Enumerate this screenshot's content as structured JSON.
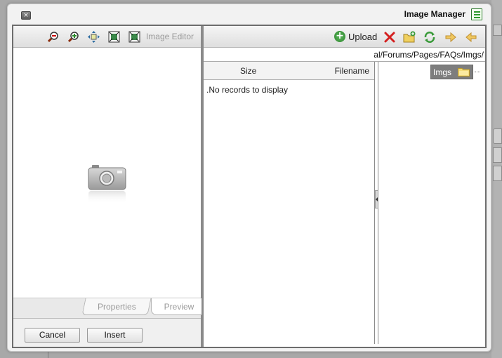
{
  "dialog": {
    "title": "Image Manager",
    "close_symbol": "×",
    "colors": {
      "toolbar": "#dedede",
      "frame": "#6d6d6d",
      "selected_node": "#7d7d7d",
      "accent_green": "#2d862d"
    }
  },
  "image_editor": {
    "label": "Image Editor",
    "tools": [
      "zoom-out-icon",
      "zoom-in-icon",
      "move-icon",
      "best-fit-icon",
      "actual-size-icon"
    ],
    "preview_icon": "camera-icon"
  },
  "tabs": {
    "properties": "Properties",
    "preview": "Preview"
  },
  "buttons": {
    "cancel": "Cancel",
    "insert": "Insert"
  },
  "file_toolbar": {
    "upload": "Upload",
    "icons": [
      "upload-icon",
      "delete-icon",
      "new-folder-icon",
      "refresh-icon",
      "forward-icon",
      "back-icon"
    ]
  },
  "path": "al/Forums/Pages/FAQs/Imgs/",
  "grid": {
    "columns": {
      "size": "Size",
      "filename": "Filename"
    },
    "empty_message": ".No records to display"
  },
  "tree": {
    "selected_folder": "Imgs"
  }
}
